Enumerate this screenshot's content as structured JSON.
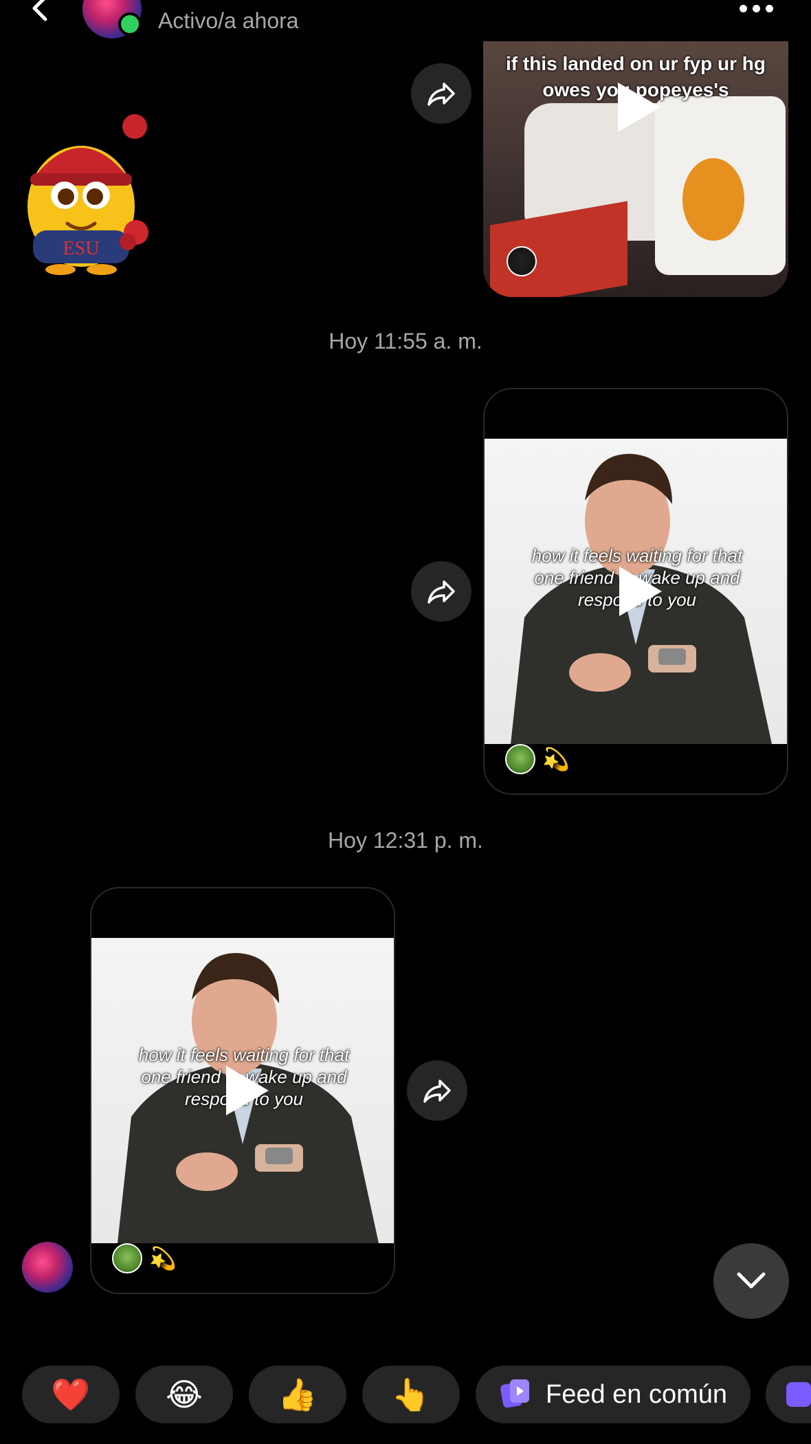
{
  "header": {
    "status": "Activo/a ahora"
  },
  "messages": {
    "card1_caption": "if this landed on ur fyp ur hg owes you popeyes's",
    "timestamp1": "Hoy 11:55 a. m.",
    "card2_caption": "how it feels waiting for that one friend to wake up and respond to you",
    "timestamp2": "Hoy 12:31 p. m.",
    "card3_caption": "how it feels waiting for that one friend to wake up and respond to you",
    "sparkle": "💫"
  },
  "reactions": [
    "❤️",
    "😂",
    "👍",
    "👆"
  ],
  "feed_chip": {
    "label": "Feed en común"
  },
  "colors": {
    "online": "#31d160",
    "chip_bg": "#262626",
    "feed_icon": "#7b5cff"
  }
}
